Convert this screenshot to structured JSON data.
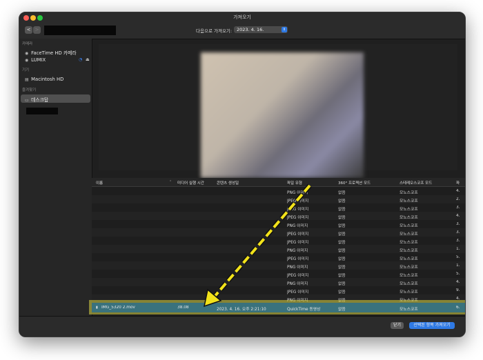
{
  "window": {
    "title": "가져오기"
  },
  "toolbar": {
    "back": "<",
    "forward": ">",
    "dest_label": "다음으로 가져오기:",
    "dest_value": "2023. 4. 16."
  },
  "sidebar": {
    "sections": [
      {
        "title": "카메라",
        "items": [
          "FaceTime HD 카메라",
          "LUMIX"
        ]
      },
      {
        "title": "기기",
        "items": [
          "Macintosh HD"
        ]
      },
      {
        "title": "즐겨찾기",
        "items": [
          "데스크탑"
        ]
      }
    ]
  },
  "table": {
    "columns": [
      "이름",
      "미디어 실행 시간",
      "콘텐츠 생성일",
      "파일 유형",
      "360° 프로젝션 모드",
      "스테레오스코프 모드",
      "파"
    ],
    "rows": [
      {
        "type": "PNG 이미지",
        "proj": "없음",
        "stereo": "모노스코프",
        "extra": "4."
      },
      {
        "type": "JPEG 이미지",
        "proj": "없음",
        "stereo": "모노스코프",
        "extra": "2."
      },
      {
        "type": "JPEG 이미지",
        "proj": "없음",
        "stereo": "모노스코프",
        "extra": "3."
      },
      {
        "type": "JPEG 이미지",
        "proj": "없음",
        "stereo": "모노스코프",
        "extra": "4."
      },
      {
        "type": "PNG 이미지",
        "proj": "없음",
        "stereo": "모노스코프",
        "extra": "3."
      },
      {
        "type": "JPEG 이미지",
        "proj": "없음",
        "stereo": "모노스코프",
        "extra": "3."
      },
      {
        "type": "JPEG 이미지",
        "proj": "없음",
        "stereo": "모노스코프",
        "extra": "3."
      },
      {
        "type": "PNG 이미지",
        "proj": "없음",
        "stereo": "모노스코프",
        "extra": "1."
      },
      {
        "type": "JPEG 이미지",
        "proj": "없음",
        "stereo": "모노스코프",
        "extra": "5."
      },
      {
        "type": "PNG 이미지",
        "proj": "없음",
        "stereo": "모노스코프",
        "extra": "1."
      },
      {
        "type": "JPEG 이미지",
        "proj": "없음",
        "stereo": "모노스코프",
        "extra": "5."
      },
      {
        "type": "PNG 이미지",
        "proj": "없음",
        "stereo": "모노스코프",
        "extra": "4."
      },
      {
        "type": "JPEG 이미지",
        "proj": "없음",
        "stereo": "모노스코프",
        "extra": "9."
      },
      {
        "type": "PNG 이미지",
        "proj": "없음",
        "stereo": "모노스코프",
        "extra": "4."
      }
    ],
    "selected": {
      "name": "IMG_5320 2.mov",
      "duration": "38.08",
      "created": "2023. 4. 16. 오후 2:21:10",
      "type": "QuickTime 동영상",
      "proj": "없음",
      "stereo": "모노스코프",
      "extra": "6."
    }
  },
  "footer": {
    "close": "닫기",
    "import": "선택된 항목 가져오기"
  },
  "colors": {
    "accent": "#2f7ae5",
    "selection": "#3a727d",
    "highlight": "#dad646"
  }
}
